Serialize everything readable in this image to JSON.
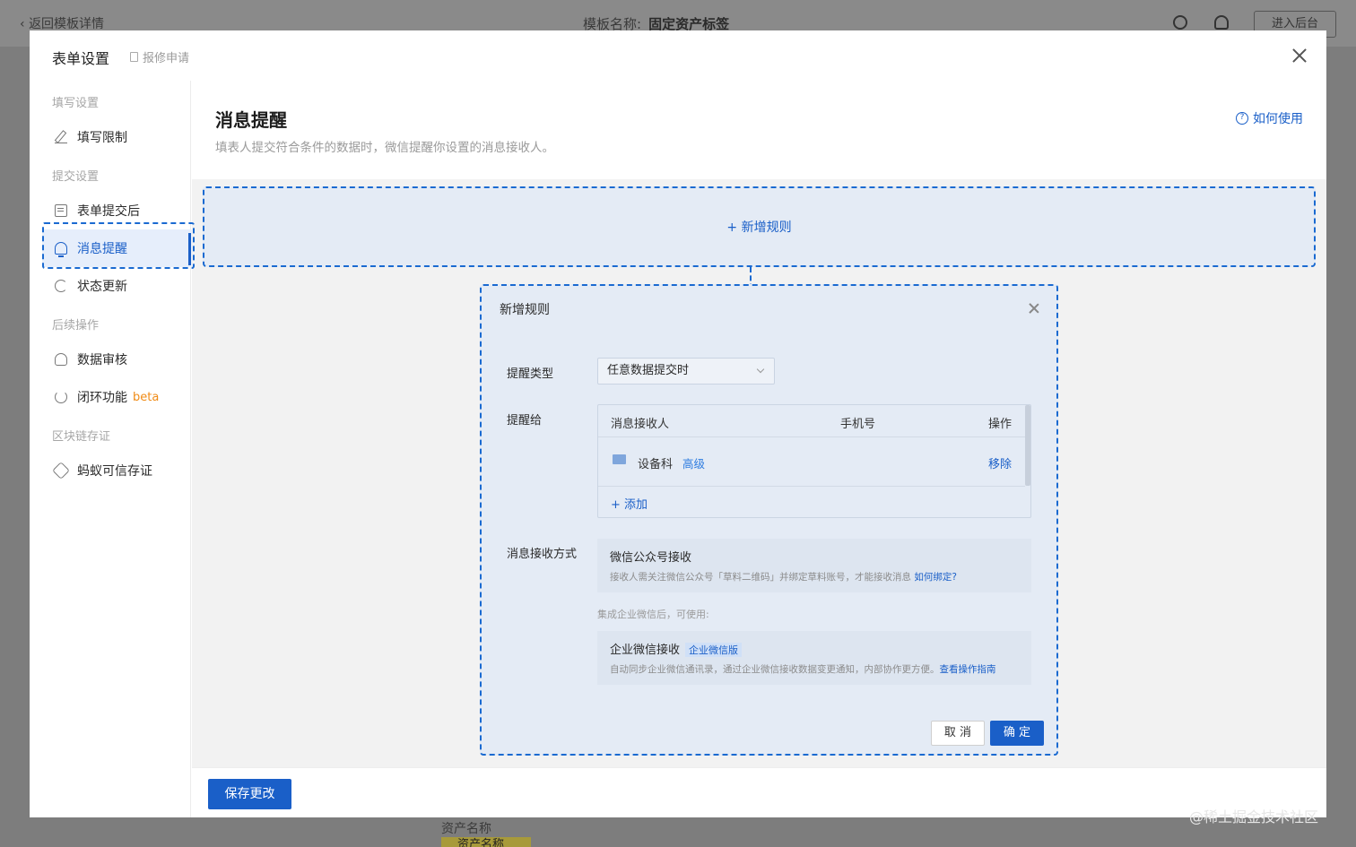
{
  "background": {
    "back_link": "返回模板详情",
    "template_label": "模板名称:",
    "template_name": "固定资产标签",
    "enter_backend": "进入后台",
    "asset_label": "资产名称",
    "asset_value": "资产名称"
  },
  "watermark": "@稀土掘金技术社区",
  "modal": {
    "title": "表单设置",
    "subtitle": "报修申请"
  },
  "sidebar": {
    "groups": [
      "填写设置",
      "提交设置",
      "后续操作",
      "区块链存证"
    ],
    "items": [
      {
        "label": "填写限制",
        "icon": "pencil-icon"
      },
      {
        "label": "表单提交后",
        "icon": "document-icon"
      },
      {
        "label": "消息提醒",
        "icon": "bell-icon",
        "active": true
      },
      {
        "label": "状态更新",
        "icon": "refresh-icon"
      },
      {
        "label": "数据审核",
        "icon": "user-icon"
      },
      {
        "label": "闭环功能",
        "icon": "loop-icon",
        "badge": "beta"
      },
      {
        "label": "蚂蚁可信存证",
        "icon": "chain-icon"
      }
    ]
  },
  "content": {
    "title": "消息提醒",
    "description": "填表人提交符合条件的数据时，微信提醒你设置的消息接收人。",
    "help_link": "如何使用",
    "add_rule": "+ 新增规则",
    "save_button": "保存更改"
  },
  "rule_dialog": {
    "title": "新增规则",
    "type_label": "提醒类型",
    "type_value": "任意数据提交时",
    "remind_label": "提醒给",
    "table": {
      "headers": [
        "消息接收人",
        "手机号",
        "操作"
      ],
      "rows": [
        {
          "name": "设备科",
          "tag": "高级",
          "action": "移除"
        }
      ],
      "add": "+ 添加"
    },
    "method_label": "消息接收方式",
    "wechat_title": "微信公众号接收",
    "wechat_desc": "接收人需关注微信公众号「草料二维码」并绑定草料账号，才能接收消息",
    "wechat_link": "如何绑定?",
    "hint": "集成企业微信后，可使用:",
    "ent_title": "企业微信接收",
    "ent_badge": "企业微信版",
    "ent_desc": "自动同步企业微信通讯录，通过企业微信接收数据变更通知，内部协作更方便。",
    "ent_link": "查看操作指南",
    "cancel": "取 消",
    "confirm": "确 定"
  },
  "colors": {
    "primary": "#1a5fc8",
    "highlight_bg": "#e4ebf5",
    "beta": "#f08b16"
  }
}
